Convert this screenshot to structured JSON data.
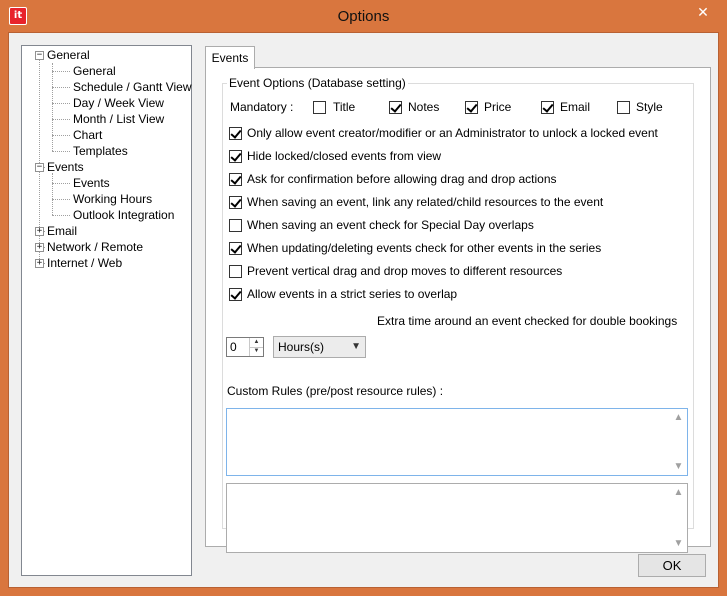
{
  "window": {
    "title": "Options",
    "app_icon": "it",
    "close_glyph": "✕"
  },
  "tree": {
    "general": {
      "label": "General",
      "expander": "−",
      "children": [
        "General",
        "Schedule / Gantt View",
        "Day / Week View",
        "Month / List View",
        "Chart",
        "Templates"
      ]
    },
    "events": {
      "label": "Events",
      "expander": "−",
      "children": [
        "Events",
        "Working Hours",
        "Outlook Integration"
      ]
    },
    "email": {
      "label": "Email",
      "expander": "+"
    },
    "network": {
      "label": "Network / Remote",
      "expander": "+"
    },
    "internet": {
      "label": "Internet / Web",
      "expander": "+"
    }
  },
  "tabs": {
    "events_label": "Events"
  },
  "event_options": {
    "legend": "Event Options (Database setting)",
    "mandatory_label": "Mandatory :",
    "mandatory": [
      {
        "label": "Title",
        "checked": false
      },
      {
        "label": "Notes",
        "checked": true
      },
      {
        "label": "Price",
        "checked": true
      },
      {
        "label": "Email",
        "checked": true
      },
      {
        "label": "Style",
        "checked": false
      }
    ],
    "options": [
      {
        "label": "Only allow event creator/modifier or an Administrator to unlock a locked event",
        "checked": true
      },
      {
        "label": "Hide locked/closed events from view",
        "checked": true
      },
      {
        "label": "Ask for confirmation before allowing drag and drop actions",
        "checked": true
      },
      {
        "label": "When saving an event, link any related/child resources to the event",
        "checked": true
      },
      {
        "label": "When saving an event check for Special Day overlaps",
        "checked": false
      },
      {
        "label": "When updating/deleting events check for other events in the series",
        "checked": true
      },
      {
        "label": "Prevent vertical drag and drop moves to different resources",
        "checked": false
      },
      {
        "label": "Allow events in a strict series to overlap",
        "checked": true
      }
    ],
    "extra_time": {
      "value": "0",
      "unit": "Hours(s)",
      "label": "Extra time around an event checked for double bookings"
    },
    "custom_rules_label": "Custom Rules (pre/post resource rules) :"
  },
  "buttons": {
    "ok": "OK"
  }
}
